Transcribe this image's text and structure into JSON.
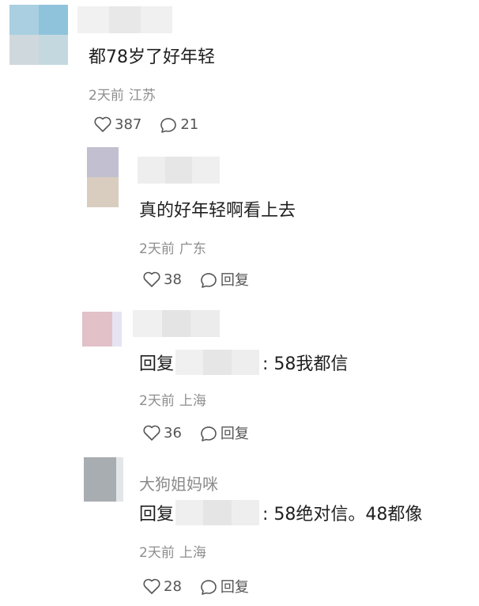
{
  "comments": [
    {
      "text": "都78岁了好年轻",
      "time": "2天前",
      "location": "江苏",
      "likes": "387",
      "reply_count": "21"
    },
    {
      "text": "真的好年轻啊看上去",
      "time": "2天前",
      "location": "广东",
      "likes": "38",
      "reply_label": "回复"
    },
    {
      "reply_prefix": "回复",
      "text": ": 58我都信",
      "time": "2天前",
      "location": "上海",
      "likes": "36",
      "reply_label": "回复"
    },
    {
      "author": "大狗姐妈咪",
      "reply_prefix": "回复",
      "text": ": 58绝对信。48都像",
      "time": "2天前",
      "location": "上海",
      "likes": "28",
      "reply_label": "回复"
    }
  ],
  "icons": {
    "like": "heart-outline-icon",
    "comment": "speech-bubble-icon"
  },
  "colors": {
    "meta_text": "#8e8e8e",
    "body_text": "#1f1f1f",
    "blur_light": "#eeeeee"
  }
}
